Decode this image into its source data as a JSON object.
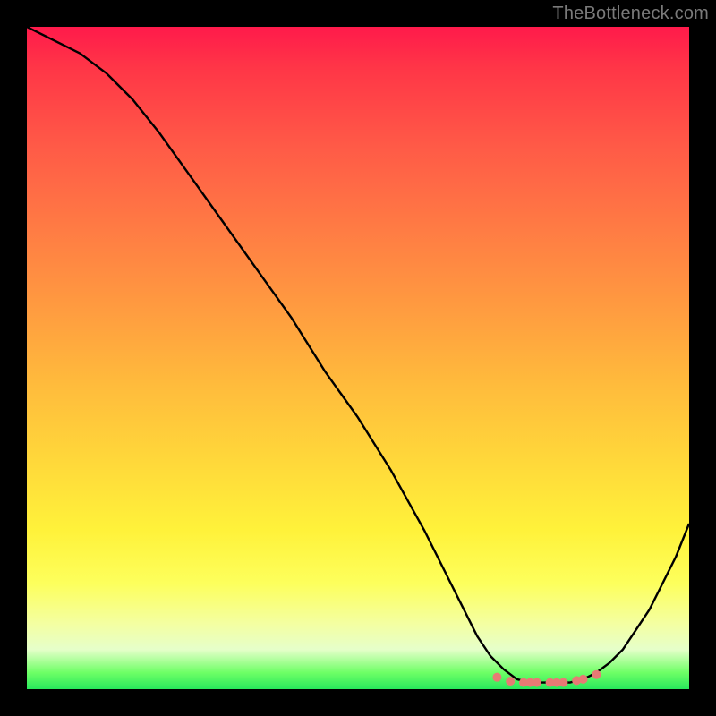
{
  "watermark": "TheBottleneck.com",
  "chart_data": {
    "type": "line",
    "title": "",
    "xlabel": "",
    "ylabel": "",
    "xlim": [
      0,
      100
    ],
    "ylim": [
      0,
      100
    ],
    "grid": false,
    "legend": false,
    "series": [
      {
        "name": "curve",
        "x": [
          0,
          4,
          8,
          12,
          16,
          20,
          25,
          30,
          35,
          40,
          45,
          50,
          55,
          60,
          62,
          64,
          66,
          68,
          70,
          72,
          74,
          76,
          78,
          80,
          82,
          84,
          86,
          88,
          90,
          92,
          94,
          96,
          98,
          100
        ],
        "y": [
          100,
          98,
          96,
          93,
          89,
          84,
          77,
          70,
          63,
          56,
          48,
          41,
          33,
          24,
          20,
          16,
          12,
          8,
          5,
          3,
          1.5,
          1,
          1,
          1,
          1,
          1.5,
          2.5,
          4,
          6,
          9,
          12,
          16,
          20,
          25
        ]
      }
    ],
    "markers": {
      "name": "flat-region-markers",
      "x": [
        71,
        73,
        75,
        76,
        77,
        79,
        80,
        81,
        83,
        84,
        86
      ],
      "y": [
        1.8,
        1.2,
        1.0,
        1.0,
        1.0,
        1.0,
        1.0,
        1.0,
        1.3,
        1.5,
        2.2
      ],
      "color": "#e77a74",
      "radius": 5
    }
  },
  "colors": {
    "line": "#000000",
    "marker": "#e77a74",
    "frame": "#000000"
  }
}
